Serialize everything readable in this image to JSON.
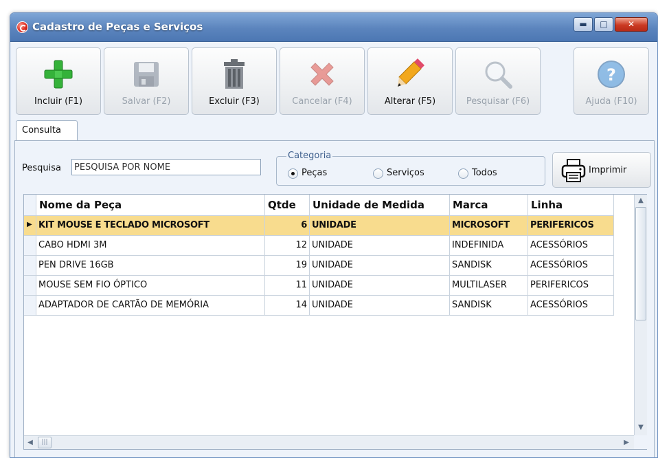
{
  "window": {
    "title": "Cadastro de Peças e Serviços"
  },
  "window_controls": {
    "minimize": "▬",
    "maximize": "□",
    "close": "✕"
  },
  "toolbar": {
    "buttons": [
      {
        "label": "Incluir (F1)",
        "icon": "plus-icon",
        "enabled": true
      },
      {
        "label": "Salvar (F2)",
        "icon": "floppy-disk-icon",
        "enabled": false
      },
      {
        "label": "Excluir (F3)",
        "icon": "trash-icon",
        "enabled": true
      },
      {
        "label": "Cancelar (F4)",
        "icon": "cancel-x-icon",
        "enabled": false
      },
      {
        "label": "Alterar (F5)",
        "icon": "pencil-icon",
        "enabled": true
      },
      {
        "label": "Pesquisar (F6)",
        "icon": "magnifier-icon",
        "enabled": false
      },
      {
        "label": "Ajuda (F10)",
        "icon": "help-icon",
        "enabled": false
      }
    ]
  },
  "tabs": [
    {
      "label": "Consulta",
      "active": true
    }
  ],
  "search": {
    "label": "Pesquisa",
    "value": "PESQUISA POR NOME"
  },
  "category": {
    "legend": "Categoria",
    "options": [
      {
        "label": "Peças",
        "selected": true
      },
      {
        "label": "Serviços",
        "selected": false
      },
      {
        "label": "Todos",
        "selected": false
      }
    ]
  },
  "print": {
    "label": "Imprimir",
    "icon": "printer-icon"
  },
  "grid": {
    "columns": [
      "Nome da Peça",
      "Qtde",
      "Unidade de Medida",
      "Marca",
      "Linha"
    ],
    "rows": [
      {
        "nome": "KIT MOUSE E TECLADO MICROSOFT",
        "qtde": "6",
        "unidade": "UNIDADE",
        "marca": "MICROSOFT",
        "linha": "PERIFERICOS",
        "selected": true
      },
      {
        "nome": "CABO HDMI 3M",
        "qtde": "12",
        "unidade": "UNIDADE",
        "marca": "INDEFINIDA",
        "linha": "ACESSÓRIOS",
        "selected": false
      },
      {
        "nome": "PEN DRIVE 16GB",
        "qtde": "19",
        "unidade": "UNIDADE",
        "marca": "SANDISK",
        "linha": "ACESSÓRIOS",
        "selected": false
      },
      {
        "nome": "MOUSE SEM FIO ÓPTICO",
        "qtde": "11",
        "unidade": "UNIDADE",
        "marca": "MULTILASER",
        "linha": "PERIFERICOS",
        "selected": false
      },
      {
        "nome": "ADAPTADOR DE CARTÃO DE MEMÓRIA",
        "qtde": "14",
        "unidade": "UNIDADE",
        "marca": "SANDISK",
        "linha": "ACESSÓRIOS",
        "selected": false
      }
    ],
    "row_indicator": "▶"
  },
  "colors": {
    "titlebar": "#5b84bd",
    "selected_row": "#f8dc8e",
    "accent": "#3e5f8d"
  }
}
